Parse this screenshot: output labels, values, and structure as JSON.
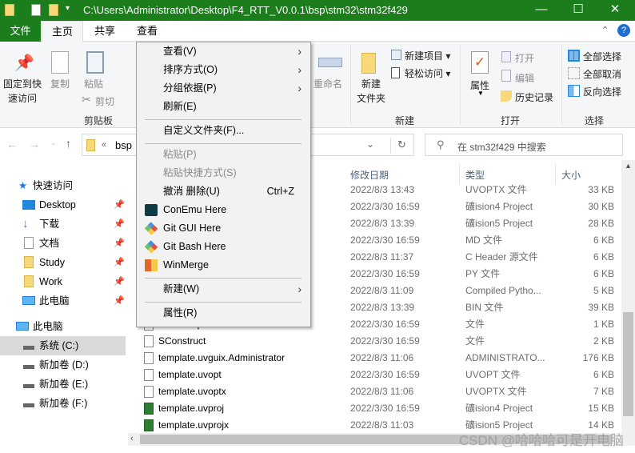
{
  "window": {
    "path": "C:\\Users\\Administrator\\Desktop\\F4_RTT_V0.0.1\\bsp\\stm32\\stm32f429",
    "minimize": "—",
    "maximize": "☐",
    "close": "✕",
    "accent": "#1b7d1b"
  },
  "tabs": [
    "文件",
    "主页",
    "共享",
    "查看"
  ],
  "ribbon": {
    "pin_quick": "固定到快\n速访问",
    "copy": "复制",
    "paste": "粘贴",
    "cut": "剪切",
    "clipboard": "剪贴板",
    "rename": "重命名",
    "new_folder": "新建\n文件夹",
    "new_item": "新建项目",
    "easy_access": "轻松访问",
    "new_group": "新建",
    "properties": "属性",
    "open": "打开",
    "edit": "编辑",
    "history": "历史记录",
    "open_group": "打开",
    "select_all": "全部选择",
    "select_none": "全部取消",
    "invert": "反向选择",
    "select_group": "选择",
    "help": "?"
  },
  "address": {
    "crumb": "bsp",
    "prefix": "«",
    "search_placeholder": "在 stm32f429 中搜索"
  },
  "sidebar": {
    "quick_access": "快速访问",
    "quick_items": [
      "Desktop",
      "下载",
      "文档",
      "Study",
      "Work",
      "此电脑"
    ],
    "this_pc": "此电脑",
    "drives": [
      "系统 (C:)",
      "新加卷 (D:)",
      "新加卷 (E:)",
      "新加卷 (F:)"
    ]
  },
  "columns": {
    "date": "修改日期",
    "type": "类型",
    "size": "大小"
  },
  "rows": [
    {
      "name": "",
      "date": "2022/8/3 13:43",
      "type": "UVOPTX 文件",
      "size": "33 KB"
    },
    {
      "name": "",
      "date": "2022/3/30 16:59",
      "type": "礦ision4 Project",
      "size": "30 KB"
    },
    {
      "name": "",
      "date": "2022/8/3 13:39",
      "type": "礦ision5 Project",
      "size": "28 KB"
    },
    {
      "name": "",
      "date": "2022/3/30 16:59",
      "type": "MD 文件",
      "size": "6 KB"
    },
    {
      "name": "",
      "date": "2022/8/3 11:37",
      "type": "C Header 源文件",
      "size": "6 KB"
    },
    {
      "name": "",
      "date": "2022/3/30 16:59",
      "type": "PY 文件",
      "size": "6 KB"
    },
    {
      "name": "",
      "date": "2022/8/3 11:09",
      "type": "Compiled Pytho...",
      "size": "5 KB"
    },
    {
      "name": "",
      "date": "2022/8/3 13:39",
      "type": "BIN 文件",
      "size": "39 KB"
    },
    {
      "name": "SConscript",
      "date": "2022/3/30 16:59",
      "type": "文件",
      "size": "1 KB"
    },
    {
      "name": "SConstruct",
      "date": "2022/3/30 16:59",
      "type": "文件",
      "size": "2 KB"
    },
    {
      "name": "template.uvguix.Administrator",
      "date": "2022/8/3 11:06",
      "type": "ADMINISTRATO...",
      "size": "176 KB"
    },
    {
      "name": "template.uvopt",
      "date": "2022/3/30 16:59",
      "type": "UVOPT 文件",
      "size": "6 KB"
    },
    {
      "name": "template.uvoptx",
      "date": "2022/8/3 11:06",
      "type": "UVOPTX 文件",
      "size": "7 KB"
    },
    {
      "name": "template.uvproj",
      "date": "2022/3/30 16:59",
      "type": "礦ision4 Project",
      "size": "15 KB"
    },
    {
      "name": "template.uvprojx",
      "date": "2022/8/3 11:03",
      "type": "礦ision5 Project",
      "size": "14 KB"
    }
  ],
  "menu": {
    "view": "查看(V)",
    "sort": "排序方式(O)",
    "group": "分组依据(P)",
    "refresh": "刷新(E)",
    "customize": "自定义文件夹(F)...",
    "paste": "粘贴(P)",
    "paste_shortcut": "粘贴快捷方式(S)",
    "undo": "撤消 删除(U)",
    "undo_shortcut": "Ctrl+Z",
    "conemu": "ConEmu Here",
    "git_gui": "Git GUI Here",
    "git_bash": "Git Bash Here",
    "winmerge": "WinMerge",
    "new": "新建(W)",
    "properties": "属性(R)",
    "arrow": "›"
  },
  "watermark": "CSDN @哈哈哈可是开电脑"
}
